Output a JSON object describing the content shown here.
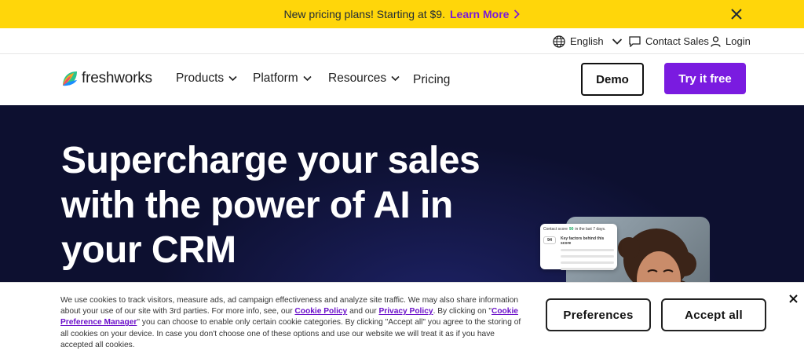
{
  "promo": {
    "text": "New pricing plans! Starting at $9.",
    "link": "Learn More"
  },
  "utility": {
    "language": "English",
    "contact": "Contact Sales",
    "login": "Login"
  },
  "nav": {
    "logo_text": "freshworks",
    "items": [
      "Products",
      "Platform",
      "Resources",
      "Pricing"
    ],
    "demo": "Demo",
    "try": "Try it free"
  },
  "hero": {
    "headline": "Supercharge your sales with the power of AI in your CRM",
    "card": {
      "score_line": "Contact score",
      "score_delta": "90",
      "score_period": "in the last 7 days.",
      "score_value": "94",
      "factors": "Key factors behind this score"
    }
  },
  "cookie": {
    "text_1": "We use cookies to track visitors, measure ads, ad campaign effectiveness and analyze site traffic. We may also share information about your use of our site with 3rd parties. For more info, see, our ",
    "link_cookie_policy": "Cookie Policy",
    "text_2": " and our ",
    "link_privacy_policy": "Privacy Policy",
    "text_3": ". By clicking on \"",
    "link_pref_manager": "Cookie Preference Manager",
    "text_4": "\" you can choose to enable only certain cookie categories. By clicking \"Accept all\" you agree to the storing of all cookies on your device. In case you don't choose one of these options and use our website we will treat it as if you have accepted all cookies.",
    "preferences": "Preferences",
    "accept_all": "Accept all"
  },
  "colors": {
    "promo_bg": "#ffd60a",
    "accent_purple": "#7a1be0",
    "hero_bg": "#0d1030"
  }
}
